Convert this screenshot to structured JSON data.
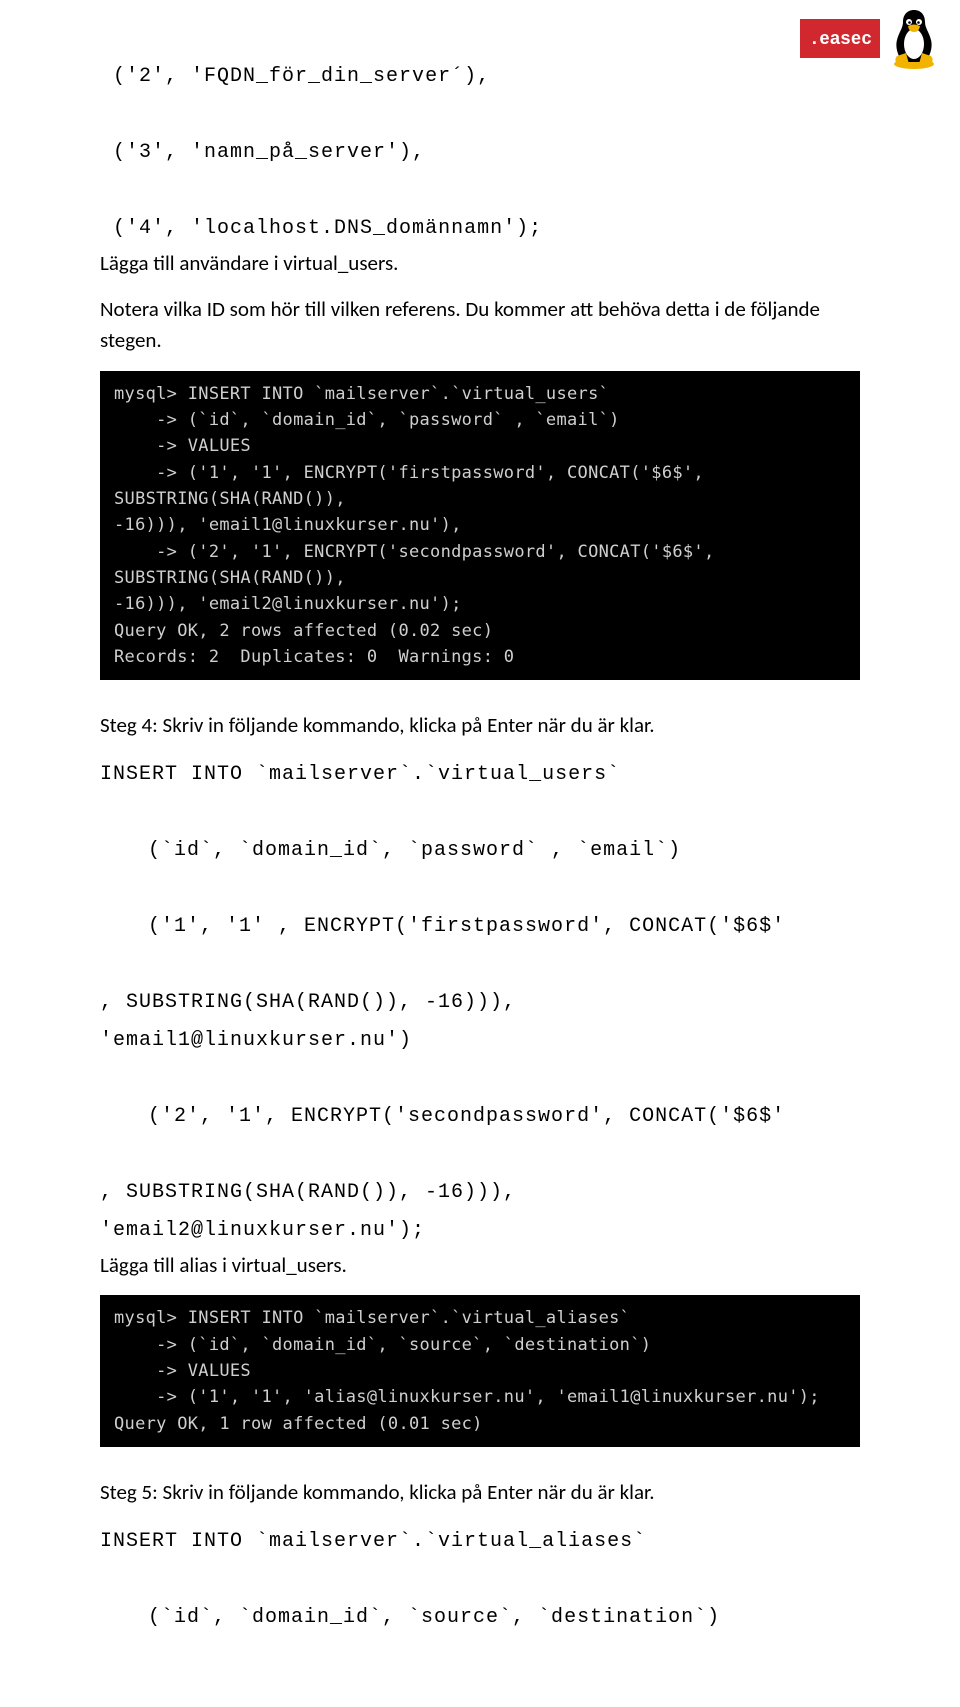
{
  "logo": {
    "dot": ".",
    "brand": "easec"
  },
  "code_top": {
    "l1": " ('2', 'FQDN_för_din_server´),",
    "l2": " ('3', 'namn_på_server'),",
    "l3": " ('4', 'localhost.DNS_domännamn');"
  },
  "para1": "Lägga till användare i virtual_users.",
  "para2": "Notera vilka ID som hör till vilken referens. Du kommer att behöva detta i de följande stegen.",
  "terminal1": "mysql> INSERT INTO `mailserver`.`virtual_users`\n    -> (`id`, `domain_id`, `password` , `email`)\n    -> VALUES\n    -> ('1', '1', ENCRYPT('firstpassword', CONCAT('$6$', SUBSTRING(SHA(RAND()),\n-16))), 'email1@linuxkurser.nu'),\n    -> ('2', '1', ENCRYPT('secondpassword', CONCAT('$6$', SUBSTRING(SHA(RAND()),\n-16))), 'email2@linuxkurser.nu');\nQuery OK, 2 rows affected (0.02 sec)\nRecords: 2  Duplicates: 0  Warnings: 0",
  "para3": "Steg 4: Skriv in följande kommando, klicka på Enter när du är klar.",
  "code_mid": {
    "l1": "INSERT INTO `mailserver`.`virtual_users`",
    "l2": "(`id`, `domain_id`, `password` , `email`)",
    "l3a": "('1', '1' , ENCRYPT('firstpassword', CONCAT('$6$'",
    "l3b": ", SUBSTRING(SHA(RAND()), -16))),",
    "l3c": "'email1@linuxkurser.nu')",
    "l4a": "('2', '1', ENCRYPT('secondpassword', CONCAT('$6$'",
    "l4b": ", SUBSTRING(SHA(RAND()), -16))),",
    "l4c": "'email2@linuxkurser.nu');"
  },
  "para4": "Lägga till alias i virtual_users.",
  "terminal2": "mysql> INSERT INTO `mailserver`.`virtual_aliases`\n    -> (`id`, `domain_id`, `source`, `destination`)\n    -> VALUES\n    -> ('1', '1', 'alias@linuxkurser.nu', 'email1@linuxkurser.nu');\nQuery OK, 1 row affected (0.01 sec)",
  "para5": "Steg 5: Skriv in följande kommando, klicka på Enter när du är klar.",
  "code_bot": {
    "l1": "INSERT INTO `mailserver`.`virtual_aliases`",
    "l2": "(`id`, `domain_id`, `source`, `destination`)"
  }
}
